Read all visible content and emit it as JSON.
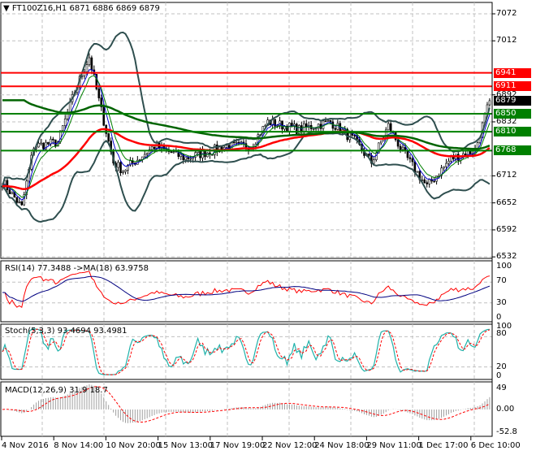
{
  "header": {
    "symbol": "FT100Z16,H1",
    "ohlc": "6871 6886 6869 6879"
  },
  "panels": {
    "rsi": {
      "title": "RSI(14) 77.3488  ->MA(18) 63.9758",
      "ticks": [
        "100",
        "70",
        "30",
        "0"
      ]
    },
    "stoch": {
      "title": "Stoch(5,3,3) 93.4694 93.4981",
      "ticks": [
        "100",
        "80",
        "20",
        "0"
      ]
    },
    "macd": {
      "title": "MACD(12,26,9) 31.9 18.7",
      "ticks": [
        "49",
        "0.00",
        "-52.8"
      ]
    }
  },
  "price_axis": [
    "7072",
    "7012",
    "6892",
    "6832",
    "6712",
    "6652",
    "6592",
    "6532"
  ],
  "levels": [
    {
      "value": "6941",
      "color": "#ff0000"
    },
    {
      "value": "6911",
      "color": "#ff0000"
    },
    {
      "value": "6850",
      "color": "#008000"
    },
    {
      "value": "6810",
      "color": "#008000"
    },
    {
      "value": "6768",
      "color": "#008000"
    }
  ],
  "current_price": {
    "value": "6879",
    "color": "#000000"
  },
  "time_axis": [
    "4 Nov 2016",
    "8 Nov 14:00",
    "10 Nov 20:00",
    "15 Nov 13:00",
    "17 Nov 19:00",
    "22 Nov 12:00",
    "24 Nov 18:00",
    "29 Nov 11:00",
    "1 Dec 17:00",
    "6 Dec 10:00"
  ],
  "chart_data": {
    "type": "candlestick",
    "title": "FT100Z16,H1",
    "ylim": [
      6532,
      7090
    ],
    "close_waypoints": [
      [
        0,
        6700
      ],
      [
        8,
        6642
      ],
      [
        13,
        6778
      ],
      [
        23,
        6787
      ],
      [
        30,
        6900
      ],
      [
        36,
        6976
      ],
      [
        40,
        6880
      ],
      [
        46,
        6742
      ],
      [
        50,
        6724
      ],
      [
        63,
        6778
      ],
      [
        76,
        6751
      ],
      [
        93,
        6778
      ],
      [
        103,
        6778
      ],
      [
        110,
        6832
      ],
      [
        123,
        6815
      ],
      [
        136,
        6832
      ],
      [
        146,
        6790
      ],
      [
        153,
        6742
      ],
      [
        160,
        6823
      ],
      [
        166,
        6765
      ],
      [
        176,
        6688
      ],
      [
        186,
        6751
      ],
      [
        196,
        6769
      ],
      [
        202,
        6879
      ]
    ],
    "indicators": [
      "Bollinger(20,2)",
      "MA red",
      "MA green",
      "MA dark green",
      "RSI(14)",
      "Stoch(5,3,3)",
      "MACD(12,26,9)"
    ]
  }
}
